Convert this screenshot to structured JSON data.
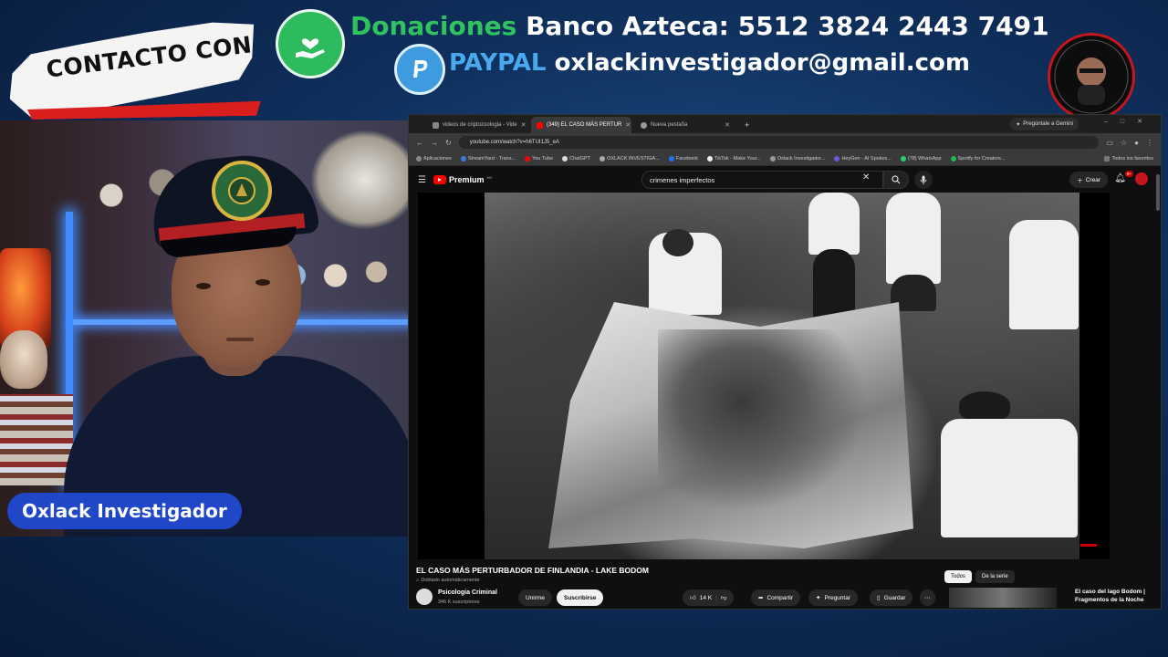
{
  "banner": {
    "contacto_label": "CONTACTO CON",
    "donation_word": "Donaciones",
    "bank_text": "Banco Azteca: 5512 3824 2443 7491",
    "paypal_word": "PAYPAL",
    "paypal_email": "oxlackinvestigador@gmail.com",
    "colors": {
      "green": "#2fc25e",
      "blue": "#4aa9ee",
      "red": "#d91e1e"
    }
  },
  "webcam": {
    "name_label": "Oxlack Investigador"
  },
  "browser": {
    "tabs": [
      {
        "label": "videos de criptozoologia - Vide",
        "active": false
      },
      {
        "label": "(349) EL CASO MÁS PERTUR",
        "active": true
      },
      {
        "label": "Nueva pestaña",
        "active": false
      }
    ],
    "new_tab": "+",
    "gemini": "Pregúntale a Gemini",
    "url": "youtube.com/watch?v=h6TUI1J5_eA",
    "bookmarks": [
      "Aplicaciones",
      "StreamYard - Trans...",
      "You Tube",
      "ChatGPT",
      "OXLACK INVESTIGA...",
      "Facebook",
      "TikTok - Make Your...",
      "Oxlack Investigador...",
      "HeyGen - AI Spokes...",
      "(78) WhatsApp",
      "Spotify for Creators..."
    ],
    "bookmarks_all": "Todos los favoritos"
  },
  "youtube": {
    "logo_text": "Premium",
    "logo_region": "MX",
    "search_value": "crimenes imperfectos",
    "create_label": "Crear",
    "notif_count": "9+",
    "video_title": "EL CASO MÁS PERTURBADOR DE FINLANDIA - LAKE BODOM",
    "dubbed_label": "Doblado automáticamente",
    "channel_name": "Psicologia Criminal",
    "channel_subs": "346 K suscriptores",
    "join_label": "Unirme",
    "subscribe_label": "Suscribirse",
    "likes": "14 K",
    "share_label": "Compartir",
    "ask_label": "Preguntar",
    "save_label": "Guardar",
    "chip_all": "Todos",
    "chip_series": "De la serie",
    "side_video_title": "El caso del lago Bodom | Fragmentos de la Noche",
    "icons": [
      "menu-icon",
      "search-icon",
      "mic-icon",
      "bell-icon",
      "like-icon",
      "dislike-icon",
      "share-icon",
      "spark-icon",
      "save-icon",
      "more-icon"
    ]
  }
}
